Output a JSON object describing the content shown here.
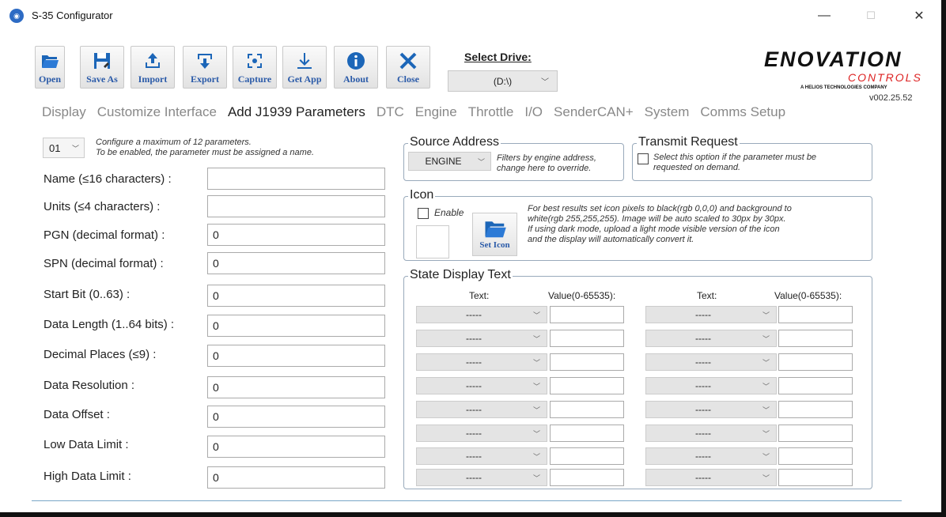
{
  "window": {
    "title": "S-35 Configurator",
    "minimize": "—",
    "maximize": "☐",
    "close": "✕"
  },
  "toolbar": [
    {
      "label": "Open",
      "icon": "folder-open-icon"
    },
    {
      "label": "Save As",
      "icon": "save-icon"
    },
    {
      "label": "Import",
      "icon": "import-icon"
    },
    {
      "label": "Export",
      "icon": "export-icon"
    },
    {
      "label": "Capture",
      "icon": "capture-icon"
    },
    {
      "label": "Get App",
      "icon": "download-icon"
    },
    {
      "label": "About",
      "icon": "info-icon"
    },
    {
      "label": "Close",
      "icon": "close-icon"
    }
  ],
  "drive": {
    "label": "Select Drive:",
    "selected": "(D:\\)"
  },
  "brand": {
    "name": "ENOVATION",
    "sub": "CONTROLS",
    "tagline": "A HELIOS TECHNOLOGIES COMPANY",
    "version": "v002.25.52"
  },
  "tabs": [
    "Display",
    "Customize Interface",
    "Add J1939 Parameters",
    "DTC",
    "Engine",
    "Throttle",
    "I/O",
    "SenderCAN+",
    "System",
    "Comms Setup"
  ],
  "active_tab": "Add J1939 Parameters",
  "param": {
    "selected": "01",
    "note_line1": "Configure a maximum of 12 parameters.",
    "note_line2": "To be enabled, the parameter must be assigned a name."
  },
  "fields": [
    {
      "label": "Name (≤16 characters) :",
      "value": ""
    },
    {
      "label": "Units (≤4 characters) :",
      "value": ""
    },
    {
      "label": "PGN (decimal format) :",
      "value": "0"
    },
    {
      "label": "SPN (decimal format) :",
      "value": "0"
    },
    {
      "label": "Start Bit (0..63) :",
      "value": "0"
    },
    {
      "label": "Data Length (1..64 bits) :",
      "value": "0"
    },
    {
      "label": "Decimal Places (≤9) :",
      "value": "0"
    },
    {
      "label": "Data Resolution :",
      "value": "0"
    },
    {
      "label": "Data Offset :",
      "value": "0"
    },
    {
      "label": "Low Data Limit :",
      "value": "0"
    },
    {
      "label": "High Data Limit :",
      "value": "0"
    }
  ],
  "source_address": {
    "title": "Source Address",
    "selected": "ENGINE",
    "note_line1": "Filters by engine address,",
    "note_line2": "change here to override."
  },
  "transmit_request": {
    "title": "Transmit Request",
    "note_line1": "Select this option if the parameter must be",
    "note_line2": "requested on demand."
  },
  "icon_group": {
    "title": "Icon",
    "enable_label": "Enable",
    "set_icon_label": "Set Icon",
    "note_line1": "For best results set icon pixels to black(rgb 0,0,0) and background to",
    "note_line2": "white(rgb 255,255,255). Image will be auto scaled to 30px by 30px.",
    "note_line3": "If using dark mode, upload a light mode visible version of the icon",
    "note_line4": "and the display will automatically convert it."
  },
  "state_display": {
    "title": "State Display Text",
    "text_header": "Text:",
    "value_header": "Value(0-65535):",
    "placeholder": "-----",
    "rows": 8
  }
}
